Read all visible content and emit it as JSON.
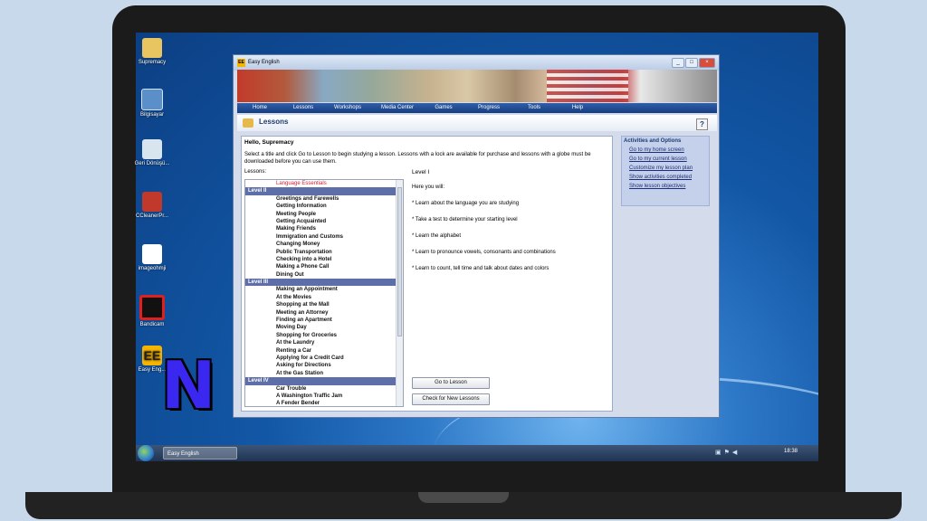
{
  "desktop": {
    "icons": [
      {
        "label": "Supremacy"
      },
      {
        "label": "Bilgisayar"
      },
      {
        "label": "Geri Dönüşü..."
      },
      {
        "label": "CCleanerPr..."
      },
      {
        "label": "imageohmji"
      },
      {
        "label": "Bandicam"
      },
      {
        "label": "Easy Eng..."
      }
    ],
    "overlay_logo": "N"
  },
  "taskbar": {
    "task_label": "Easy English",
    "tray_icons": [
      "network-icon",
      "flag-icon",
      "speaker-icon"
    ],
    "clock": "18:38"
  },
  "window": {
    "title": "Easy English",
    "app_icon": "EE",
    "controls": {
      "minimize": "_",
      "maximize": "□",
      "close": "×"
    }
  },
  "nav": {
    "items": [
      "Home",
      "Lessons",
      "Workshops",
      "Media Center",
      "Games",
      "Progress",
      "Tools",
      "Help"
    ]
  },
  "page": {
    "title": "Lessons",
    "help": "?"
  },
  "content": {
    "greeting": "Hello, Supremacy",
    "intro": "Select a title and click Go to Lesson to begin studying a lesson. Lessons with a lock are available for purchase and lessons with a globe must be downloaded before you can use them.",
    "lessons_label": "Lessons:",
    "lesson_list": [
      {
        "type": "lesson",
        "label": "Language Essentials",
        "locked": true
      },
      {
        "type": "level",
        "label": "Level II"
      },
      {
        "type": "lesson",
        "label": "Greetings and Farewells"
      },
      {
        "type": "lesson",
        "label": "Getting Information"
      },
      {
        "type": "lesson",
        "label": "Meeting People"
      },
      {
        "type": "lesson",
        "label": "Getting Acquainted"
      },
      {
        "type": "lesson",
        "label": "Making Friends"
      },
      {
        "type": "lesson",
        "label": "Immigration and Customs"
      },
      {
        "type": "lesson",
        "label": "Changing Money"
      },
      {
        "type": "lesson",
        "label": "Public Transportation"
      },
      {
        "type": "lesson",
        "label": "Checking into a Hotel"
      },
      {
        "type": "lesson",
        "label": "Making a Phone Call"
      },
      {
        "type": "lesson",
        "label": "Dining Out"
      },
      {
        "type": "level",
        "label": "Level III"
      },
      {
        "type": "lesson",
        "label": "Making an Appointment"
      },
      {
        "type": "lesson",
        "label": "At the Movies"
      },
      {
        "type": "lesson",
        "label": "Shopping at the Mall"
      },
      {
        "type": "lesson",
        "label": "Meeting an Attorney"
      },
      {
        "type": "lesson",
        "label": "Finding an Apartment"
      },
      {
        "type": "lesson",
        "label": "Moving Day"
      },
      {
        "type": "lesson",
        "label": "Shopping for Groceries"
      },
      {
        "type": "lesson",
        "label": "At the Laundry"
      },
      {
        "type": "lesson",
        "label": "Renting a Car"
      },
      {
        "type": "lesson",
        "label": "Applying for a Credit Card"
      },
      {
        "type": "lesson",
        "label": "Asking for Directions"
      },
      {
        "type": "lesson",
        "label": "At the Gas Station"
      },
      {
        "type": "level",
        "label": "Level IV"
      },
      {
        "type": "lesson",
        "label": "Car Trouble"
      },
      {
        "type": "lesson",
        "label": "A Washington Traffic Jam"
      },
      {
        "type": "lesson",
        "label": "A Fender Bender"
      }
    ],
    "detail": {
      "title": "Level I",
      "intro": "Here you will:",
      "objectives": [
        "* Learn about the language you are studying",
        "* Take a test to determine your starting level",
        "* Learn the alphabet",
        "* Learn to pronounce vowels, consonants and combinations",
        "* Learn to count, tell time and talk about dates and colors"
      ]
    },
    "buttons": {
      "go_to_lesson": "Go to Lesson",
      "check_new": "Check for New Lessons"
    }
  },
  "side_panel": {
    "title": "Activities and Options",
    "links": [
      "Go to my home screen",
      "Go to my current lesson",
      "Customize my lesson plan",
      "Show activities completed",
      "Show lesson objectives"
    ]
  }
}
